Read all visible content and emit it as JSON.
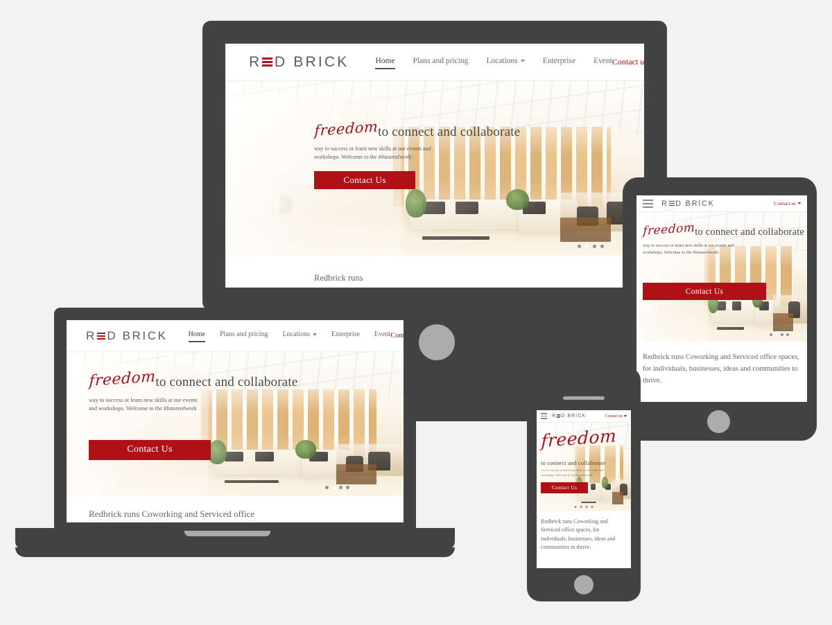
{
  "brand": {
    "name_before": "R",
    "name_after": "D BRICK",
    "accent_color": "#b01116",
    "logo_icon": "red-brick-logo"
  },
  "nav": {
    "links": [
      {
        "label": "Home",
        "active": true,
        "has_caret": false
      },
      {
        "label": "Plans and pricing",
        "active": false,
        "has_caret": false
      },
      {
        "label": "Locations",
        "active": false,
        "has_caret": true
      },
      {
        "label": "Enterprise",
        "active": false,
        "has_caret": false
      },
      {
        "label": "Event",
        "active": false,
        "has_caret": false
      }
    ],
    "contact_label": "Contact us",
    "menu_icon": "hamburger-menu-icon"
  },
  "hero": {
    "headline_script": "freedom",
    "headline_rest": "to connect and collaborate",
    "subcopy": "way to success or learn new skills at our events and workshops. Welcome to the #futureofwork",
    "cta_label": "Contact Us",
    "image_alt": "modern bright coworking office interior with wood panels, white sofas and plants",
    "carousel": {
      "total": 4,
      "active_index": 1
    }
  },
  "intro": {
    "text": "Redbrick runs Coworking and Serviced office spaces, for individuals, businesses, ideas and communities to thrive.",
    "text_truncated": "Redbrick runs Coworking and Serviced office"
  },
  "devices": [
    {
      "name": "desktop-monitor"
    },
    {
      "name": "laptop"
    },
    {
      "name": "tablet"
    },
    {
      "name": "smartphone"
    }
  ],
  "theme": {
    "page_background": "#f2f2f2",
    "device_body": "#434343",
    "device_button": "#acacac",
    "text_muted": "#666666"
  }
}
